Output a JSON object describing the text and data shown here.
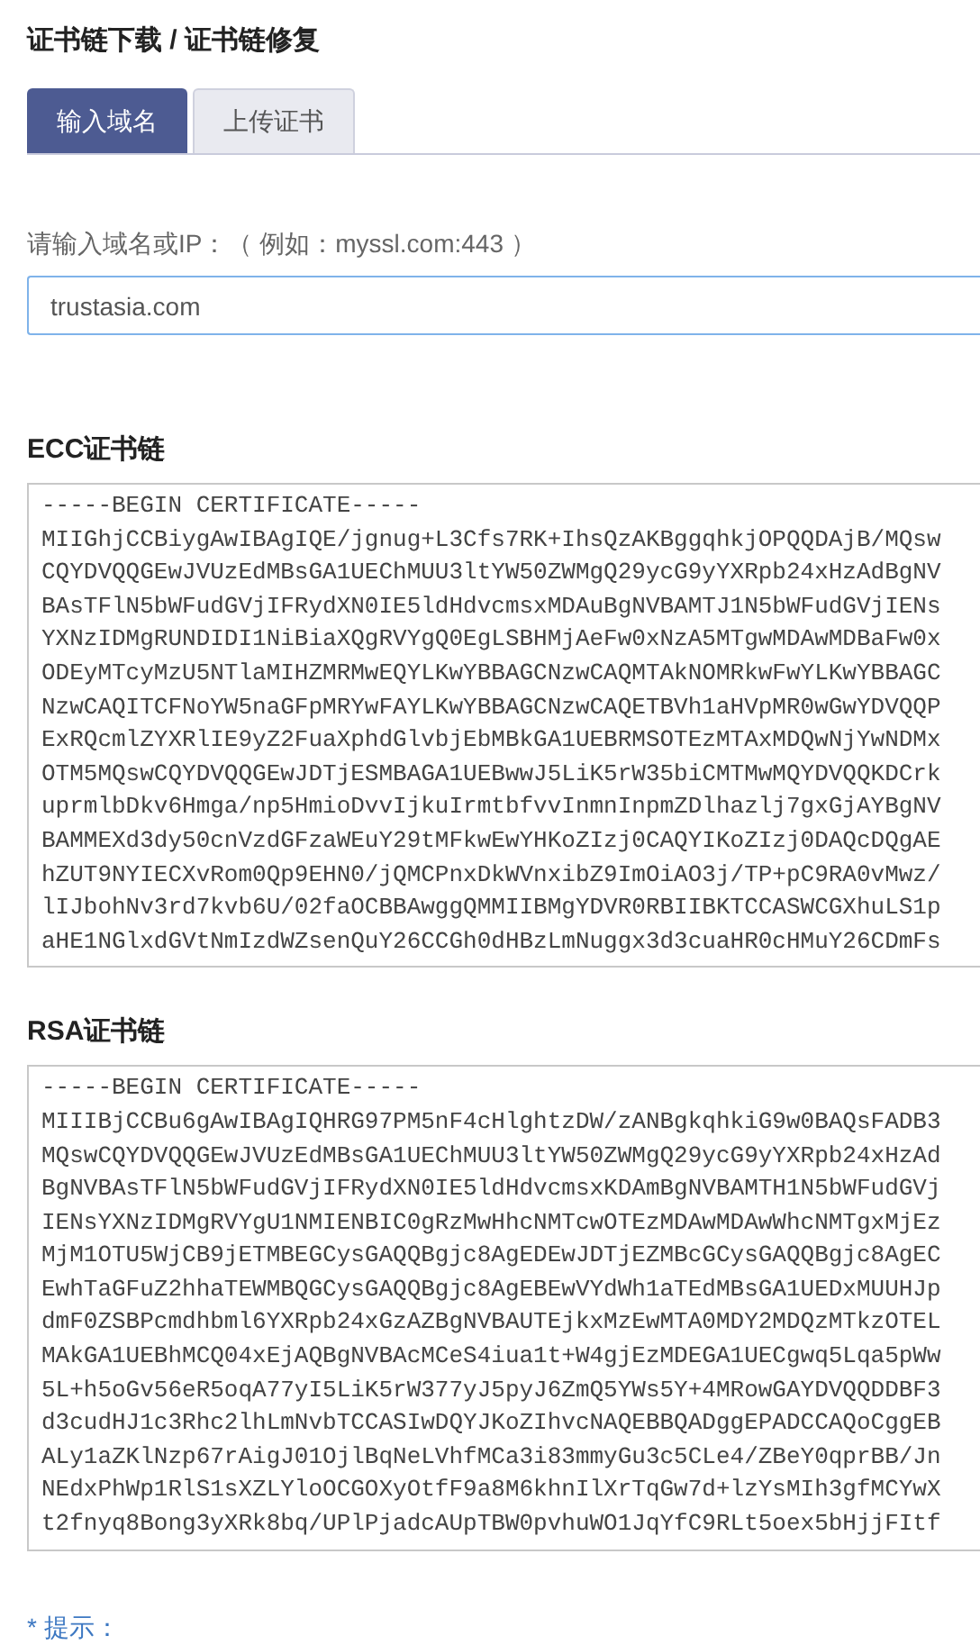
{
  "page_title": "证书链下载 / 证书链修复",
  "tabs": [
    {
      "label": "输入域名",
      "selected": true
    },
    {
      "label": "上传证书",
      "selected": false
    }
  ],
  "domain_field": {
    "label": "请输入域名或IP：（ 例如：myssl.com:443 ）",
    "value": "trustasia.com"
  },
  "chains": [
    {
      "heading": "ECC证书链",
      "lines": [
        "-----BEGIN CERTIFICATE-----",
        "MIIGhjCCBiygAwIBAgIQE/jgnug+L3Cfs7RK+IhsQzAKBggqhkjOPQQDAjB/MQsw",
        "CQYDVQQGEwJVUzEdMBsGA1UEChMUU3ltYW50ZWMgQ29ycG9yYXRpb24xHzAdBgNV",
        "BAsTFlN5bWFudGVjIFRydXN0IE5ldHdvcmsxMDAuBgNVBAMTJ1N5bWFudGVjIENs",
        "YXNzIDMgRUNDIDI1NiBiaXQgRVYgQ0EgLSBHMjAeFw0xNzA5MTgwMDAwMDBaFw0x",
        "ODEyMTcyMzU5NTlaMIHZMRMwEQYLKwYBBAGCNzwCAQMTAkNOMRkwFwYLKwYBBAGC",
        "NzwCAQITCFNoYW5naGFpMRYwFAYLKwYBBAGCNzwCAQETBVh1aHVpMR0wGwYDVQQP",
        "ExRQcmlZYXRlIE9yZ2FuaXphdGlvbjEbMBkGA1UEBRMSOTEzMTAxMDQwNjYwNDMx",
        "OTM5MQswCQYDVQQGEwJDTjESMBAGA1UEBwwJ5LiK5rW35biCMTMwMQYDVQQKDCrk",
        "uprmlbDkv6Hmga/np5HmioDvvIjkuIrmtbfvvInmnInpmZDlhazlj7gxGjAYBgNV",
        "BAMMEXd3dy50cnVzdGFzaWEuY29tMFkwEwYHKoZIzj0CAQYIKoZIzj0DAQcDQgAE",
        "hZUT9NYIECXvRom0Qp9EHN0/jQMCPnxDkWVnxibZ9ImOiAO3j/TP+pC9RA0vMwz/",
        "lIJbohNv3rd7kvb6U/02faOCBBAwggQMMIIBMgYDVR0RBIIBKTCCASWCGXhuLS1p",
        "aHE1NGlxdGVtNmIzdWZsenQuY26CCGh0dHBzLmNuggx3d3cuaHR0cHMuY26CDmFs"
      ]
    },
    {
      "heading": "RSA证书链",
      "lines": [
        "-----BEGIN CERTIFICATE-----",
        "MIIIBjCCBu6gAwIBAgIQHRG97PM5nF4cHlghtzDW/zANBgkqhkiG9w0BAQsFADB3",
        "MQswCQYDVQQGEwJVUzEdMBsGA1UEChMUU3ltYW50ZWMgQ29ycG9yYXRpb24xHzAd",
        "BgNVBAsTFlN5bWFudGVjIFRydXN0IE5ldHdvcmsxKDAmBgNVBAMTH1N5bWFudGVj",
        "IENsYXNzIDMgRVYgU1NMIENBIC0gRzMwHhcNMTcwOTEzMDAwMDAwWhcNMTgxMjEz",
        "MjM1OTU5WjCB9jETMBEGCysGAQQBgjc8AgEDEwJDTjEZMBcGCysGAQQBgjc8AgEC",
        "EwhTaGFuZ2hhaTEWMBQGCysGAQQBgjc8AgEBEwVYdWh1aTEdMBsGA1UEDxMUUHJp",
        "dmF0ZSBPcmdhbml6YXRpb24xGzAZBgNVBAUTEjkxMzEwMTA0MDY2MDQzMTkzOTEL",
        "MAkGA1UEBhMCQ04xEjAQBgNVBAcMCeS4iua1t+W4gjEzMDEGA1UECgwq5Lqa5pWw",
        "5L+h5oGv56eR5oqA77yI5LiK5rW377yJ5pyJ6ZmQ5YWs5Y+4MRowGAYDVQQDDBF3",
        "d3cudHJ1c3Rhc2lhLmNvbTCCASIwDQYJKoZIhvcNAQEBBQADggEPADCCAQoCggEB",
        "ALy1aZKlNzp67rAigJ01OjlBqNeLVhfMCa3i83mmyGu3c5CLe4/ZBeY0qprBB/Jn",
        "NEdxPhWp1RlS1sXZLYloOCGOXyOtfF9a8M6khnIlXrTqGw7d+lzYsMIh3gfMCYwX",
        "t2fnyq8Bong3yXRk8bq/UPlPjadcAUpTBW0pvhuWO1JqYfC9RLt5oex5bHjjFItf"
      ]
    }
  ],
  "hint": "* 提示："
}
